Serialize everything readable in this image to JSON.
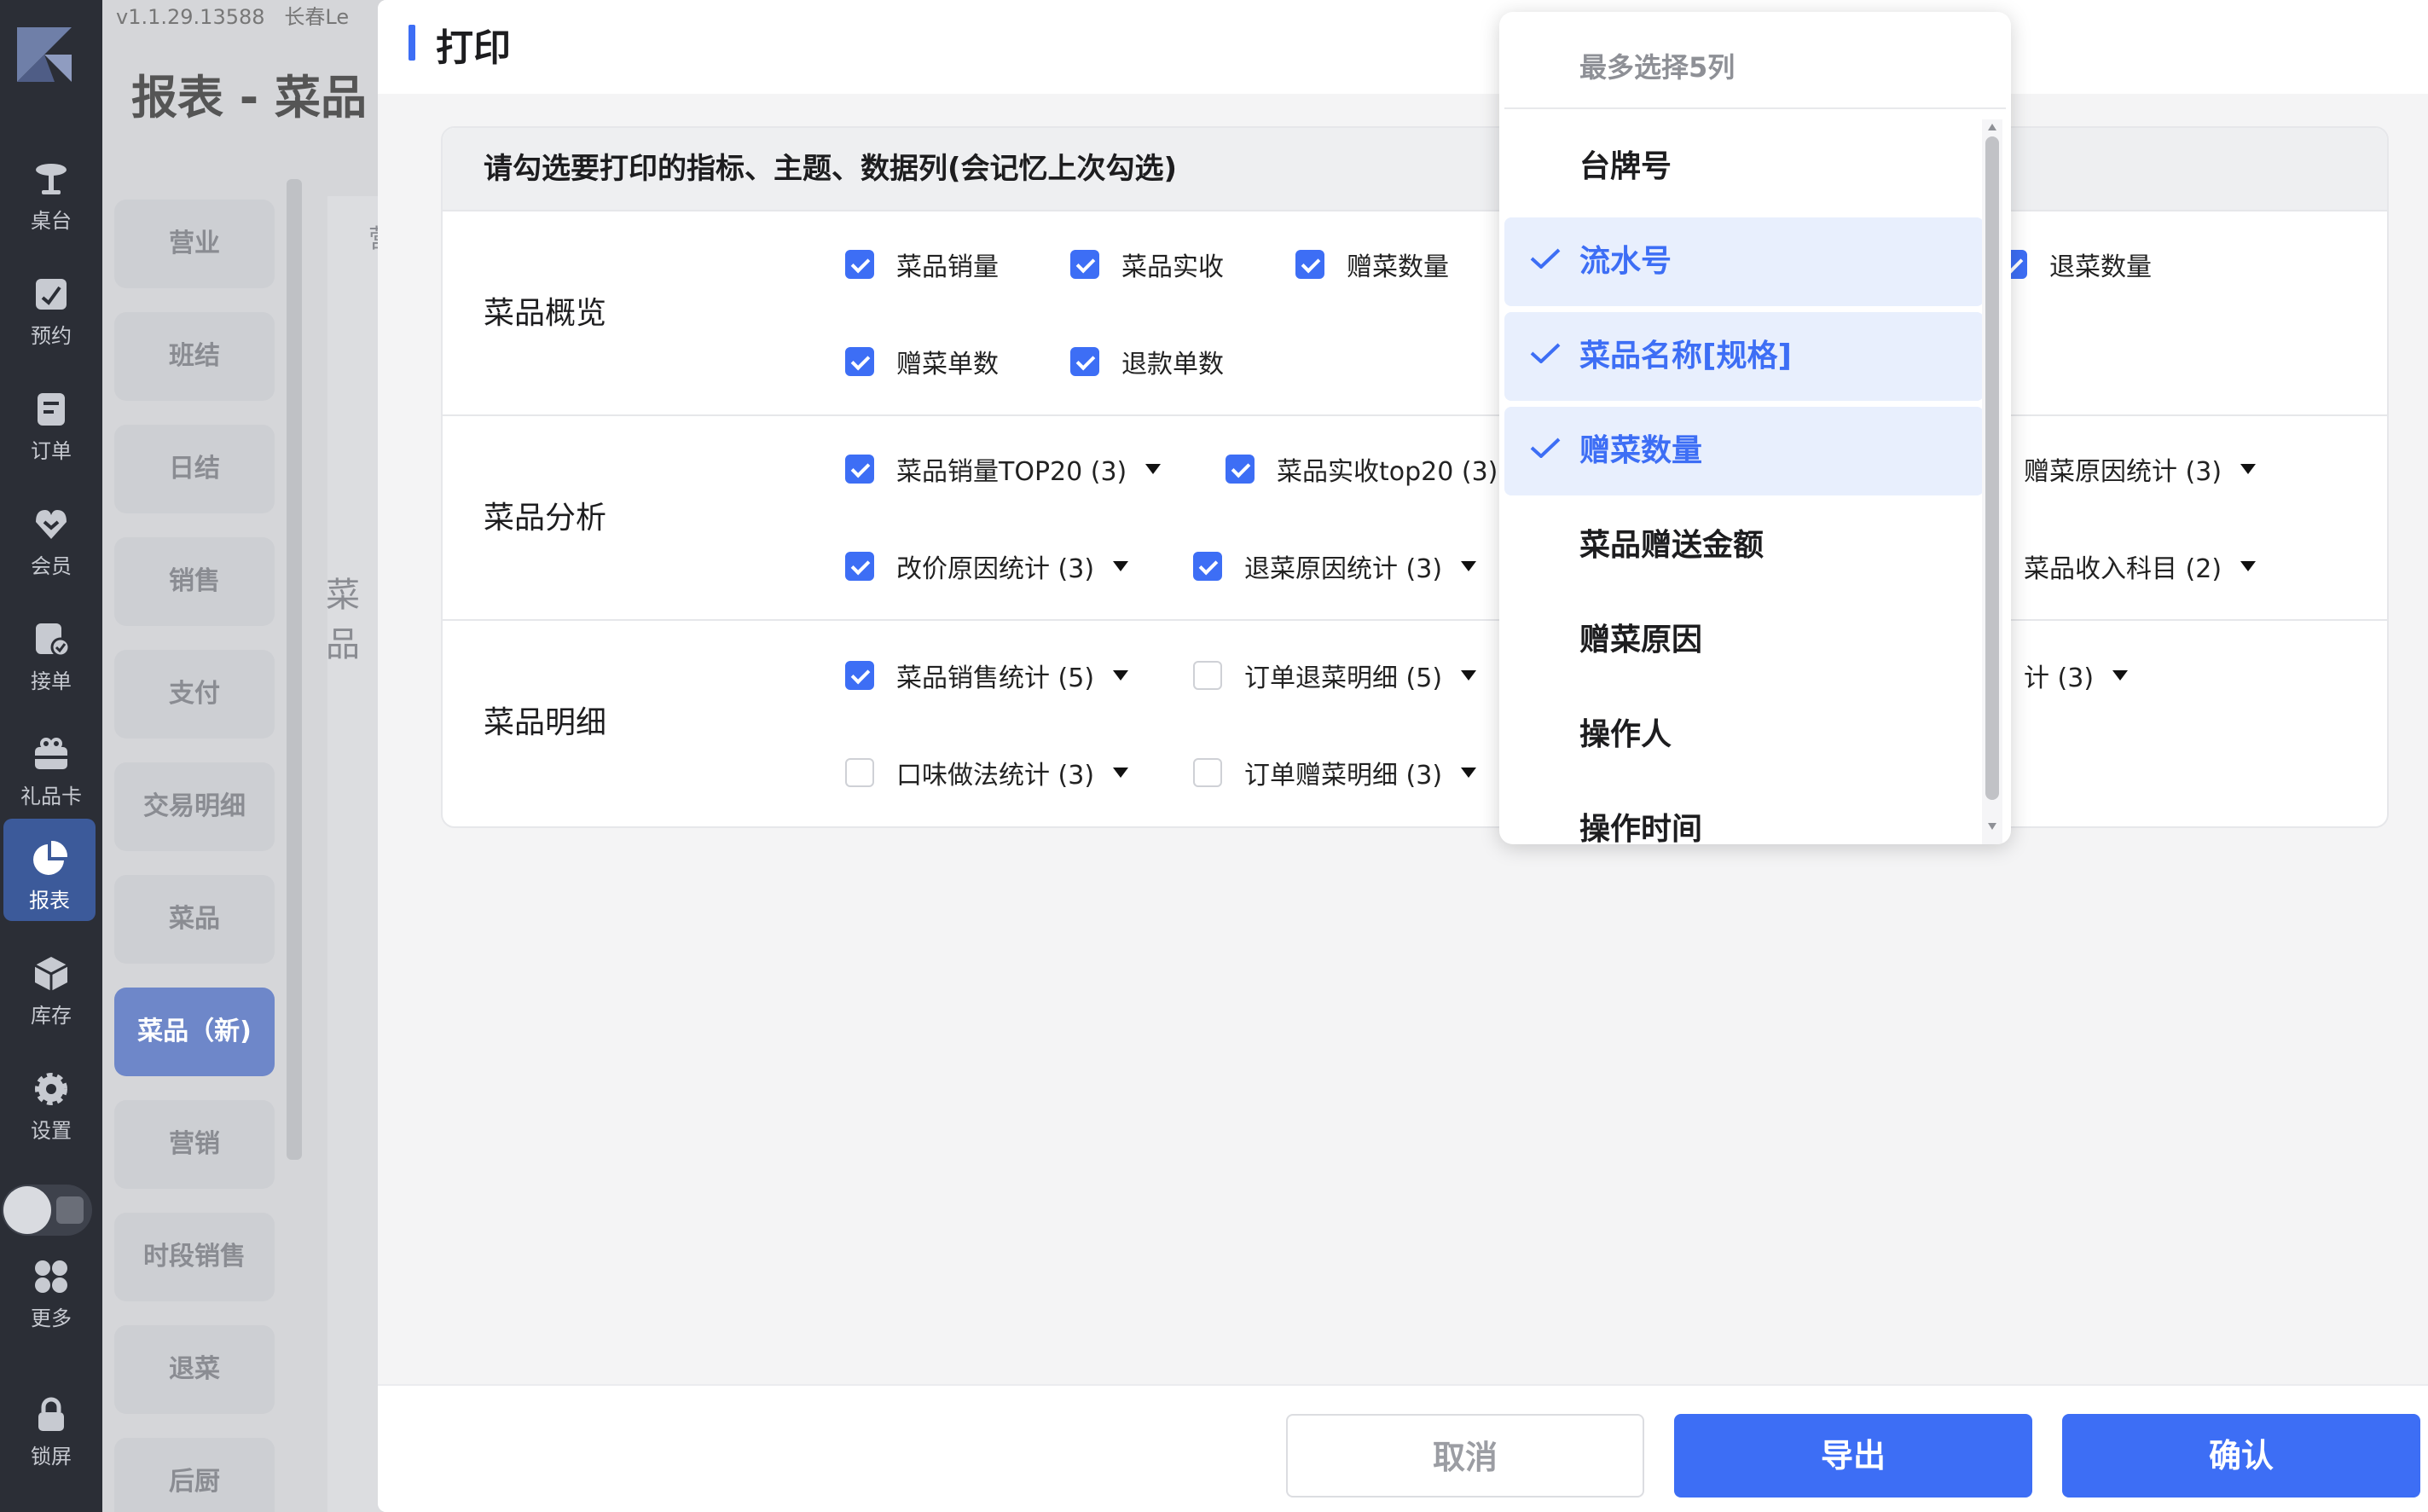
{
  "nav": {
    "items": [
      {
        "label": "桌台",
        "icon": "table-icon"
      },
      {
        "label": "预约",
        "icon": "reservation-icon"
      },
      {
        "label": "订单",
        "icon": "order-icon"
      },
      {
        "label": "会员",
        "icon": "member-icon"
      },
      {
        "label": "接单",
        "icon": "accept-order-icon"
      },
      {
        "label": "礼品卡",
        "icon": "gift-card-icon"
      },
      {
        "label": "报表",
        "icon": "report-icon",
        "active": true
      },
      {
        "label": "库存",
        "icon": "inventory-icon"
      },
      {
        "label": "设置",
        "icon": "settings-icon"
      },
      {
        "label": "更多",
        "icon": "more-icon"
      },
      {
        "label": "锁屏",
        "icon": "lock-icon"
      }
    ]
  },
  "background": {
    "version": "v1.1.29.13588",
    "store": "长春Le",
    "page_title": "报表 - 菜品",
    "subnav": [
      "营业",
      "班结",
      "日结",
      "销售",
      "支付",
      "交易明细",
      "菜品",
      "菜品（新)",
      "营销",
      "时段销售",
      "退菜",
      "后厨"
    ],
    "subnav_active": "菜品（新)",
    "frag_1": "营",
    "frag_2": "菜品"
  },
  "dialog": {
    "title": "打印",
    "card_header": "请勾选要打印的指标、主题、数据列(会记忆上次勾选)",
    "sections": [
      {
        "label": "菜品概览",
        "options": [
          {
            "text": "菜品销量",
            "checked": true
          },
          {
            "text": "菜品实收",
            "checked": true
          },
          {
            "text": "赠菜数量",
            "checked": true
          },
          {
            "text": "退菜数量",
            "checked": true
          },
          {
            "text": "赠菜单数",
            "checked": true
          },
          {
            "text": "退款单数",
            "checked": true
          }
        ]
      },
      {
        "label": "菜品分析",
        "options": [
          {
            "text": "菜品销量TOP20 (3)",
            "checked": true
          },
          {
            "text": "菜品实收top20 (3)",
            "checked": true
          },
          {
            "text": "赠菜原因统计 (3)",
            "checked": true
          },
          {
            "text": "改价原因统计 (3)",
            "checked": true
          },
          {
            "text": "退菜原因统计 (3)",
            "checked": true
          },
          {
            "text": "菜品收入科目 (2)",
            "checked": true
          }
        ]
      },
      {
        "label": "菜品明细",
        "options": [
          {
            "text": "菜品销售统计 (5)",
            "checked": true
          },
          {
            "text": "订单退菜明细 (5)",
            "checked": false
          },
          {
            "text": "计 (3)",
            "checked": false
          },
          {
            "text": "口味做法统计 (3)",
            "checked": false
          },
          {
            "text": "订单赠菜明细 (3)",
            "checked": false
          }
        ]
      }
    ],
    "buttons": {
      "cancel": "取消",
      "export": "导出",
      "confirm": "确认"
    }
  },
  "dropdown": {
    "hint": "最多选择5列",
    "items": [
      {
        "label": "台牌号",
        "selected": false
      },
      {
        "label": "流水号",
        "selected": true
      },
      {
        "label": "菜品名称[规格]",
        "selected": true
      },
      {
        "label": "赠菜数量",
        "selected": true
      },
      {
        "label": "菜品赠送金额",
        "selected": false
      },
      {
        "label": "赠菜原因",
        "selected": false
      },
      {
        "label": "操作人",
        "selected": false
      },
      {
        "label": "操作时间",
        "selected": false
      }
    ]
  },
  "colors": {
    "accent": "#3d6ef5",
    "selected_bg": "#e8effd",
    "nav_bg": "#2b2e36"
  }
}
